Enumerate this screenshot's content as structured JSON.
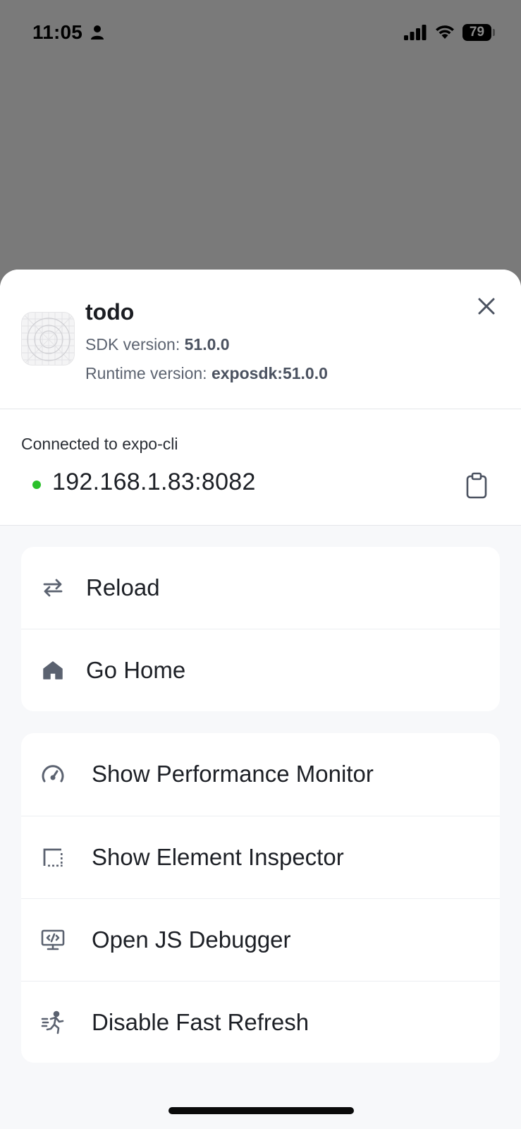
{
  "status_bar": {
    "time": "11:05",
    "battery": "79",
    "icons": [
      "person-icon",
      "signal-icon",
      "wifi-icon",
      "battery-icon"
    ]
  },
  "app": {
    "name": "todo",
    "sdk_label": "SDK version:",
    "sdk_value": "51.0.0",
    "runtime_label": "Runtime version:",
    "runtime_value": "exposdk:51.0.0",
    "icon": "app-placeholder-icon"
  },
  "connection": {
    "label": "Connected to expo-cli",
    "url": "192.168.1.83:8082",
    "status_color": "#2bc02b",
    "copy_icon": "clipboard-icon"
  },
  "menu": {
    "primary": [
      {
        "label": "Reload",
        "icon": "reload-icon"
      },
      {
        "label": "Go Home",
        "icon": "home-icon"
      }
    ],
    "tools": [
      {
        "label": "Show Performance Monitor",
        "icon": "speedometer-icon"
      },
      {
        "label": "Show Element Inspector",
        "icon": "inspector-icon"
      },
      {
        "label": "Open JS Debugger",
        "icon": "debugger-icon"
      },
      {
        "label": "Disable Fast Refresh",
        "icon": "fast-refresh-icon"
      }
    ]
  },
  "colors": {
    "backdrop": "#7a7a7a",
    "sheet_background": "#f7f8fa",
    "card_background": "#ffffff",
    "icon_color": "#5b6270"
  }
}
